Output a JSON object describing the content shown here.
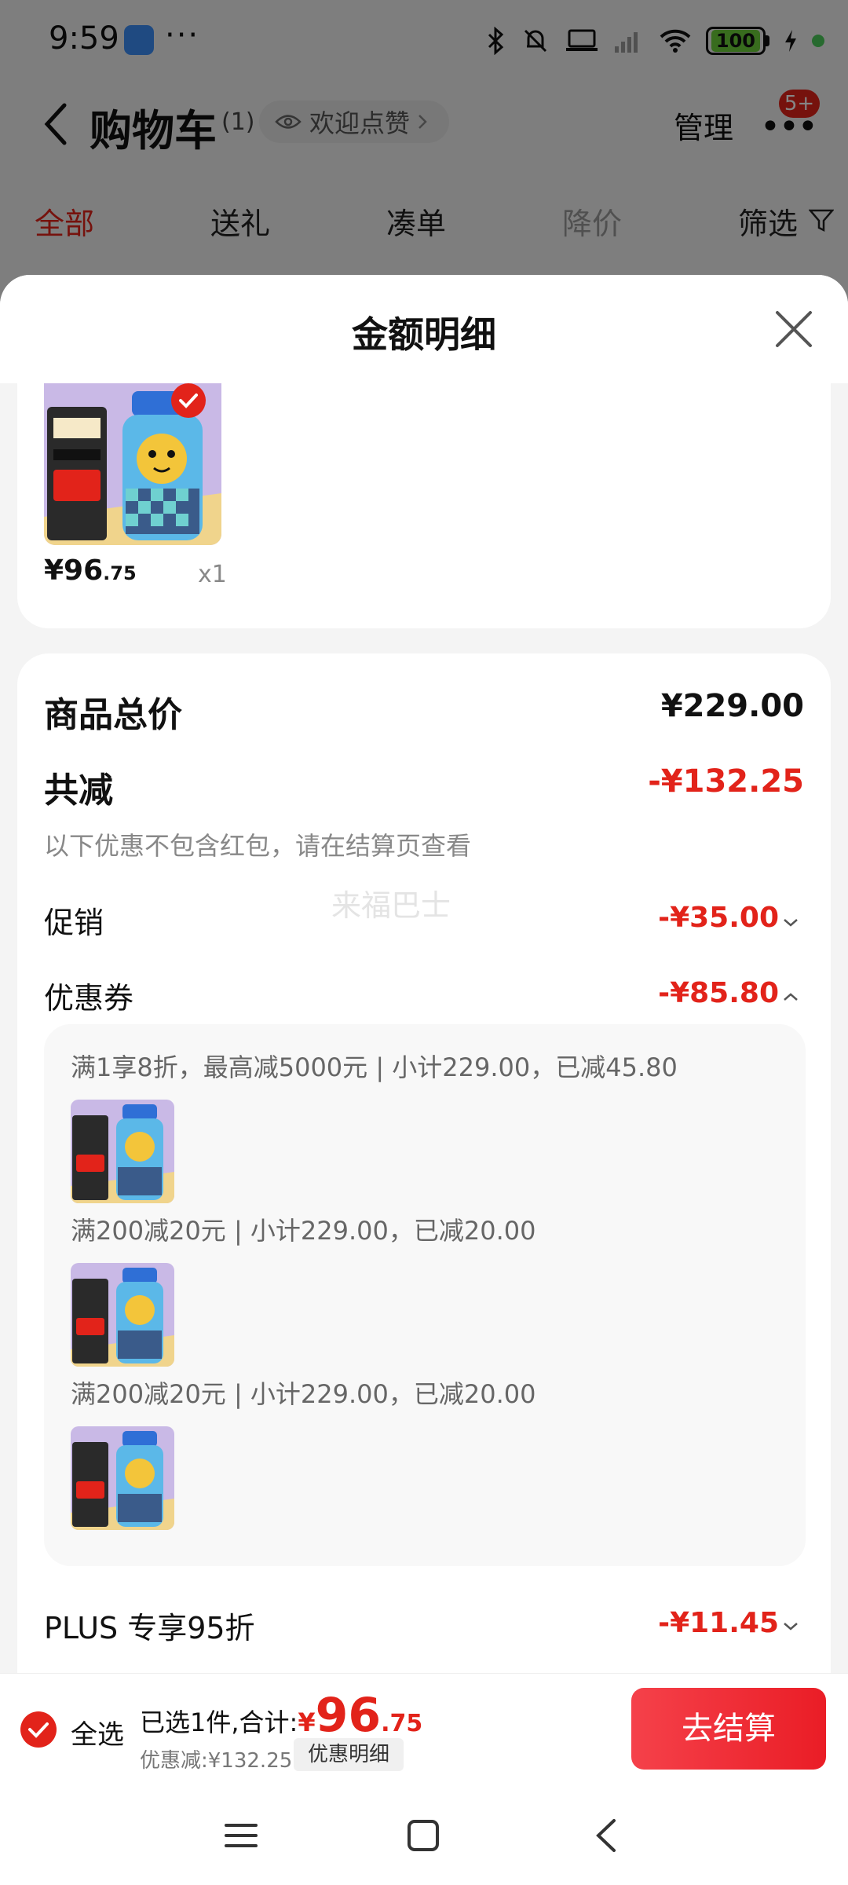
{
  "status_bar": {
    "time": "9:59",
    "more": "···",
    "battery": "100"
  },
  "nav": {
    "title": "购物车",
    "count": "(1)",
    "welcome": "欢迎点赞",
    "manage": "管理",
    "badge": "5+"
  },
  "filter_tabs": [
    "全部",
    "送礼",
    "凑单",
    "降价",
    "筛选"
  ],
  "sheet": {
    "title": "金额明细",
    "product": {
      "price_int": "¥96",
      "price_dec": ".75",
      "qty": "x1"
    },
    "rows": {
      "total_label": "商品总价",
      "total_value": "¥229.00",
      "reduce_label": "共减",
      "reduce_value": "-¥132.25",
      "reduce_note": "以下优惠不包含红包，请在结算页查看",
      "promo_label": "促销",
      "promo_value": "-¥35.00",
      "coupon_label": "优惠券",
      "coupon_value": "-¥85.80",
      "plus_label": "PLUS 专享95折",
      "plus_value": "-¥11.45"
    },
    "watermark": "来福巴士",
    "coupons": [
      {
        "text": "满1享8折，最高减5000元 | 小计229.00，已减45.80"
      },
      {
        "text": "满200减20元 | 小计229.00，已减20.00"
      },
      {
        "text": "满200减20元 | 小计229.00，已减20.00"
      }
    ]
  },
  "checkout": {
    "select_all": "全选",
    "summary": "已选1件,合计:",
    "total_yen": "¥",
    "total_int": "96",
    "total_dec": ".75",
    "discount": "优惠减:¥132.25",
    "discount_detail": "优惠明细",
    "checkout_button": "去结算"
  },
  "colors": {
    "accent": "#e2231a",
    "button": "#ea1d26"
  },
  "icons": [
    "back-icon",
    "eye-icon",
    "filter-icon",
    "close-icon",
    "check-icon",
    "chevron-down-icon",
    "chevron-up-icon",
    "menu-icon",
    "home-icon",
    "back-nav-icon"
  ]
}
